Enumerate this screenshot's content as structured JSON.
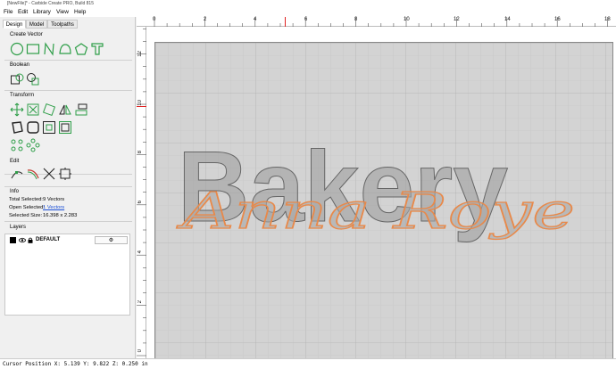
{
  "window": {
    "title": "[NewFile]* - Carbide Create PRO, Build 815"
  },
  "menu": [
    "File",
    "Edit",
    "Library",
    "View",
    "Help"
  ],
  "tabs": [
    "Design",
    "Model",
    "Toolpaths"
  ],
  "sections": {
    "create_vector": "Create Vector",
    "boolean": "Boolean",
    "transform": "Transform",
    "edit": "Edit",
    "info": "Info",
    "layers": "Layers"
  },
  "info": {
    "total_selected_label": "Total Selected:",
    "total_selected_value": "9 Vectors",
    "open_selected_label": "Open Selected:",
    "open_selected_value": "1 Vectors",
    "selected_size_label": "Selected Size:",
    "selected_size_value": "16.398 x 2.283"
  },
  "layers": [
    {
      "name": "DEFAULT"
    }
  ],
  "ruler": {
    "x": [
      "0",
      "2",
      "4",
      "6",
      "8",
      "10",
      "12",
      "14",
      "16",
      "18"
    ],
    "y": [
      "12",
      "10",
      "8",
      "6",
      "4",
      "2",
      "0"
    ]
  },
  "design": {
    "main_text": "Bakery",
    "script_text": "Anna Roye"
  },
  "status": {
    "cursor": "Cursor Position X: 5.139 Y: 9.822 Z: 0.250 in"
  },
  "colors": {
    "accent": "#2e9e48",
    "script_outline": "#e8894a",
    "text_fill": "#9a9a9a",
    "cursor_marker": "#e02020"
  }
}
